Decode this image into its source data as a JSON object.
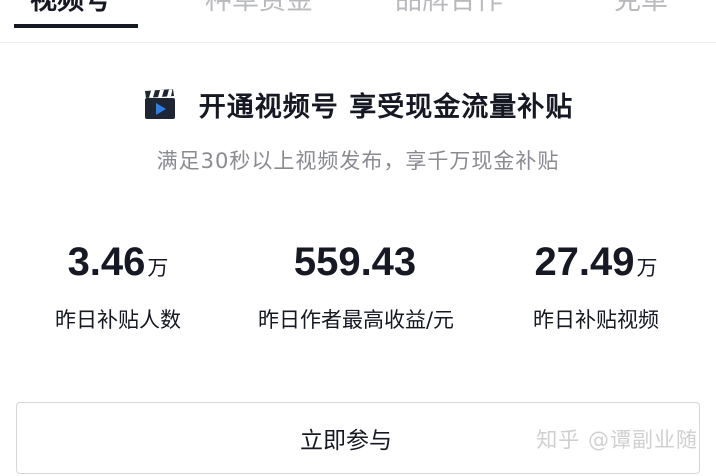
{
  "tabs": [
    {
      "label": "视频号",
      "active": true
    },
    {
      "label": "种草赏金",
      "active": false
    },
    {
      "label": "品牌合作",
      "active": false
    },
    {
      "label": "克革",
      "active": false
    }
  ],
  "headline": {
    "icon": "film-clapperboard-icon",
    "title": "开通视频号 享受现金流量补贴"
  },
  "subtitle": "满足30秒以上视频发布，享千万现金补贴",
  "stats": [
    {
      "value": "3.46",
      "unit": "万",
      "label": "昨日补贴人数"
    },
    {
      "value": "559.43",
      "unit": "",
      "label": "昨日作者最高收益/元"
    },
    {
      "value": "27.49",
      "unit": "万",
      "label": "昨日补贴视频"
    }
  ],
  "join_button": {
    "label": "立即参与"
  },
  "watermark": "知乎 @谭副业随",
  "colors": {
    "text_primary": "#161823",
    "text_secondary": "#8a8b91",
    "tab_inactive": "#b9babd",
    "button_border": "#d6d7d9",
    "icon_blue": "#2f7fe0"
  }
}
